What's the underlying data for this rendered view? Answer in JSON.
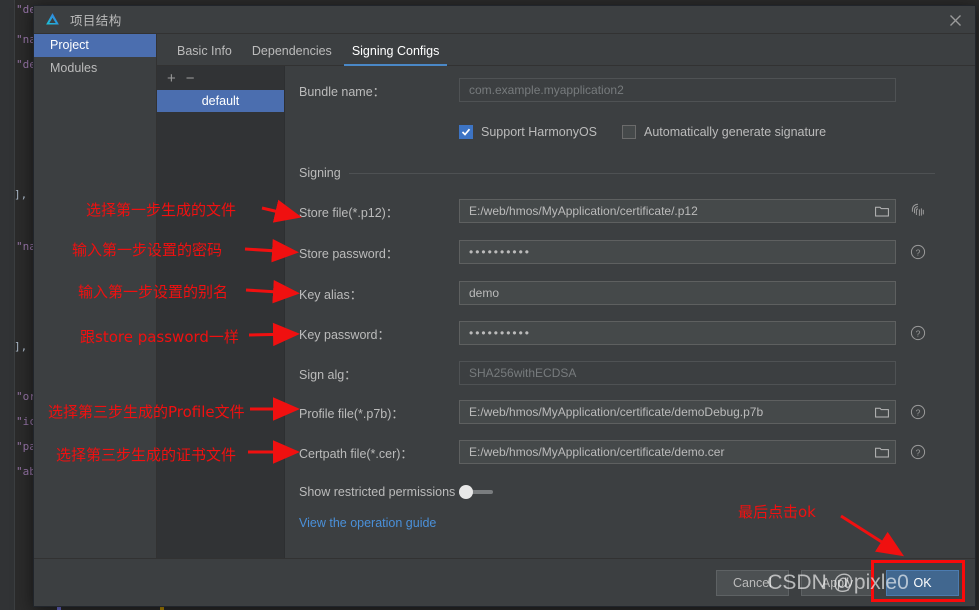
{
  "background": {
    "code_lines": [
      "\"description\": \"$string:module_description\"",
      "\"name\": \"default\",",
      "\"deviceTypes\": [",
      "],",
      "\"name\": \"EntryAbility\",",
      "],",
      "\"orientation\": \"auto_rotation\",",
      "\"icon\": \"$media:icon\",",
      "\"pages\": \"$profile:main_pages\",",
      "\"abilities\": ["
    ]
  },
  "titlebar": {
    "title": "项目结构",
    "app_icon": "deveco-logo-icon",
    "close_icon": "close-icon"
  },
  "nav": {
    "items": [
      {
        "label": "Project",
        "selected": true
      },
      {
        "label": "Modules",
        "selected": false
      }
    ]
  },
  "tabs": [
    {
      "label": "Basic Info",
      "active": false
    },
    {
      "label": "Dependencies",
      "active": false
    },
    {
      "label": "Signing Configs",
      "active": true
    }
  ],
  "config_list": {
    "add_label": "+",
    "remove_label": "−",
    "items": [
      {
        "label": "default",
        "selected": true
      }
    ]
  },
  "form": {
    "bundle_name": {
      "label": "Bundle name：",
      "value": "com.example.myapplication2",
      "readonly": true
    },
    "checkboxes": [
      {
        "label": "Support HarmonyOS",
        "checked": true
      },
      {
        "label": "Automatically generate signature",
        "checked": false
      }
    ],
    "section_title": "Signing",
    "fields": [
      {
        "label": "Store file(*.p12)：",
        "value": "E:/web/hmos/MyApplication/certificate/.p12",
        "readonly": false,
        "browse": true,
        "trailing_icon": "fingerprint-icon"
      },
      {
        "label": "Store password：",
        "value": "••••••••••",
        "masked": true,
        "readonly": false,
        "browse": false,
        "trailing_icon": "help-icon"
      },
      {
        "label": "Key alias：",
        "value": "demo",
        "readonly": false,
        "browse": false,
        "trailing_icon": ""
      },
      {
        "label": "Key password：",
        "value": "••••••••••",
        "masked": true,
        "readonly": false,
        "browse": false,
        "trailing_icon": "help-icon"
      },
      {
        "label": "Sign alg：",
        "value": "SHA256withECDSA",
        "readonly": true,
        "browse": false,
        "trailing_icon": ""
      },
      {
        "label": "Profile file(*.p7b)：",
        "value": "E:/web/hmos/MyApplication/certificate/demoDebug.p7b",
        "readonly": false,
        "browse": true,
        "trailing_icon": "help-icon"
      },
      {
        "label": "Certpath file(*.cer)：",
        "value": "E:/web/hmos/MyApplication/certificate/demo.cer",
        "readonly": false,
        "browse": true,
        "trailing_icon": "help-icon"
      }
    ],
    "restricted_permissions": {
      "label": "Show restricted permissions",
      "enabled": false
    },
    "guide_link": "View the operation guide"
  },
  "footer": {
    "cancel": "Cancel",
    "apply": "Apply",
    "ok": "OK"
  },
  "annotations": [
    {
      "text": "选择第一步生成的文件"
    },
    {
      "text": "输入第一步设置的密码"
    },
    {
      "text": "输入第一步设置的别名"
    },
    {
      "text": "跟store password一样"
    },
    {
      "text": "选择第三步生成的Profile文件"
    },
    {
      "text": "选择第三步生成的证书文件"
    },
    {
      "text": "最后点击ok"
    }
  ],
  "watermark": "CSDN @pixle0",
  "colors": {
    "accent": "#4b6eaf",
    "tab_underline": "#4a88c7",
    "annotation_red": "#f01010",
    "link_blue": "#4a90d9",
    "dialog_bg": "#3c3f41",
    "panel_bg": "#313335"
  }
}
